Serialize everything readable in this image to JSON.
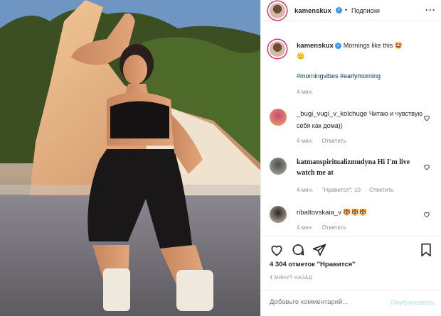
{
  "post": {
    "username": "kamenskux",
    "follow_label": "Подписки",
    "caption": "Mornings like this 🤩",
    "caption_emoji": "😑",
    "hashtags": "#morningvibes #earlymorning",
    "caption_time": "4 мин."
  },
  "comments": [
    {
      "username": "_bugi_vugi_v_kolchuge",
      "text": "Читаю и чувствую себя как дома))",
      "time": "4 мин.",
      "reply": "Ответить",
      "likes": ""
    },
    {
      "username": "katmanspiritualizmudyna",
      "text": "Hi I'm live watch me at",
      "time": "4 мин.",
      "likes": "\"Нравится\": 10",
      "reply": "Ответить"
    },
    {
      "username": "ribaltovskaia_v",
      "text": "🐯🐯🐯",
      "time": "4 мин.",
      "reply": "Ответить",
      "likes": ""
    }
  ],
  "actions": {
    "likes_text": "4 304 отметок \"Нравится\"",
    "posted_ago": "4 МИНУТ НАЗАД"
  },
  "comment_box": {
    "placeholder": "Добавьте комментарий...",
    "publish_label": "Опубликовать"
  },
  "colors": {
    "accent": "#3897f0",
    "link": "#00376b",
    "muted": "#8e8e8e",
    "publish_disabled": "#b2dffc"
  },
  "icons": [
    "heart-icon",
    "comment-icon",
    "share-icon",
    "bookmark-icon",
    "verified-icon",
    "more-options-icon"
  ]
}
